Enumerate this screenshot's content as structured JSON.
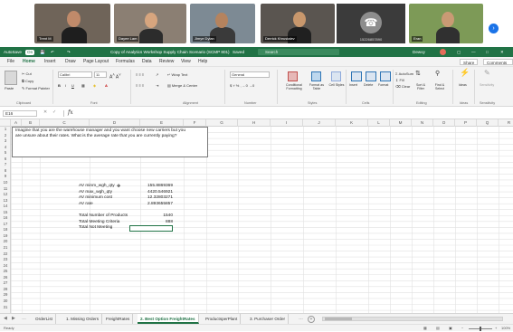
{
  "video_call": {
    "participants": [
      {
        "name": "Trent M",
        "bg": "#6f6459",
        "skin": "#c08a6a",
        "shirt": "#1e1e1e"
      },
      {
        "name": "Dayee Lam",
        "bg": "#8b7f73",
        "skin": "#d7a57e",
        "shirt": "#2c2c2c"
      },
      {
        "name": "Jimye Dylan",
        "bg": "#7d8a94",
        "skin": "#b5835e",
        "shirt": "#3a3a3a"
      },
      {
        "name": "Derrick Khrustalev",
        "bg": "#5a5550",
        "skin": "#c8976c",
        "shirt": "#202020"
      }
    ],
    "phone_number": "15226857890",
    "last_participant": {
      "name": "Eran",
      "bg": "#7d9a57",
      "skin": "#c99a74",
      "shirt": "#303030"
    },
    "next_button": "›"
  },
  "titlebar": {
    "autosave": "AutoSave",
    "autosave_state": "On",
    "file_name": "Copy of Analytics Workshop Supply Chain Scenario (SCMP 801)",
    "saved_state": "Saved",
    "search_placeholder": "Search",
    "user_name": "Dewvy",
    "accent": "#217346"
  },
  "menu": {
    "items": [
      "File",
      "Home",
      "Insert",
      "Draw",
      "Page Layout",
      "Formulas",
      "Data",
      "Review",
      "View",
      "Help"
    ],
    "active": "Home",
    "share": "Share",
    "comments": "Comments"
  },
  "ribbon": {
    "cut": "Cut",
    "copy": "Copy",
    "format_painter": "Format Painter",
    "paste": "Paste",
    "font_name": "Calibri",
    "font_size": "11",
    "wrap_text": "Wrap Text",
    "merge_center": "Merge & Center",
    "number_format": "General",
    "conditional_formatting": "Conditional Formatting",
    "format_as_table": "Format as Table",
    "cell_styles": "Cell Styles",
    "insert": "Insert",
    "delete": "Delete",
    "format": "Format",
    "autosum": "AutoSum",
    "fill": "Fill",
    "clear": "Clear",
    "sort_filter": "Sort & Filter",
    "find_select": "Find & Select",
    "ideas": "Ideas",
    "sensitivity": "Sensitivity",
    "groups": [
      "Clipboard",
      "Font",
      "Alignment",
      "Number",
      "Styles",
      "Cells",
      "Editing",
      "Ideas",
      "Sensitivity"
    ]
  },
  "formula_bar": {
    "name_box": "E16",
    "fx": "fx",
    "content": ""
  },
  "grid": {
    "columns": [
      "A",
      "B",
      "C",
      "D",
      "E",
      "F",
      "G",
      "H",
      "I",
      "J",
      "K",
      "L",
      "M",
      "N",
      "O",
      "P",
      "Q",
      "R",
      "S",
      "T"
    ],
    "rows": [
      "1",
      "2",
      "3",
      "4",
      "5",
      "6",
      "7",
      "8",
      "9",
      "10",
      "11",
      "12",
      "13",
      "14",
      "15",
      "16",
      "17",
      "18",
      "19",
      "20",
      "21",
      "22",
      "23",
      "24",
      "25",
      "26",
      "27",
      "28",
      "29",
      "30",
      "31"
    ],
    "note_lines": [
      "Imagine that you are the warehouse manager and you want choose new carriers but you",
      "are unsure about their rates.  What is the average rate that you are currently paying?"
    ],
    "stats": [
      {
        "label": "AV minm_wgh_qty",
        "value": "155.8869369"
      },
      {
        "label": "AV max_wgh_qty",
        "value": "4420.546921"
      },
      {
        "label": "AV minimum cost",
        "value": "12.32803271"
      },
      {
        "label": "AV rate",
        "value": "2.893655857"
      }
    ],
    "totals": [
      {
        "label": "Total Number of Products",
        "value": "1540"
      },
      {
        "label": "Total Meeting Criteria",
        "value": "888"
      },
      {
        "label": "Total Not Meeting",
        "value": ""
      }
    ]
  },
  "sheet_tabs": {
    "tabs": [
      "OrderList",
      "1. Missing Orders",
      "FreightRates",
      "2. Best Option FreightRates",
      "ProductsperPlant",
      "3. Purchaser Order"
    ],
    "active": "2. Best Option FreightRates",
    "add": "+"
  },
  "status_bar": {
    "ready": "Ready",
    "zoom": "100%"
  }
}
